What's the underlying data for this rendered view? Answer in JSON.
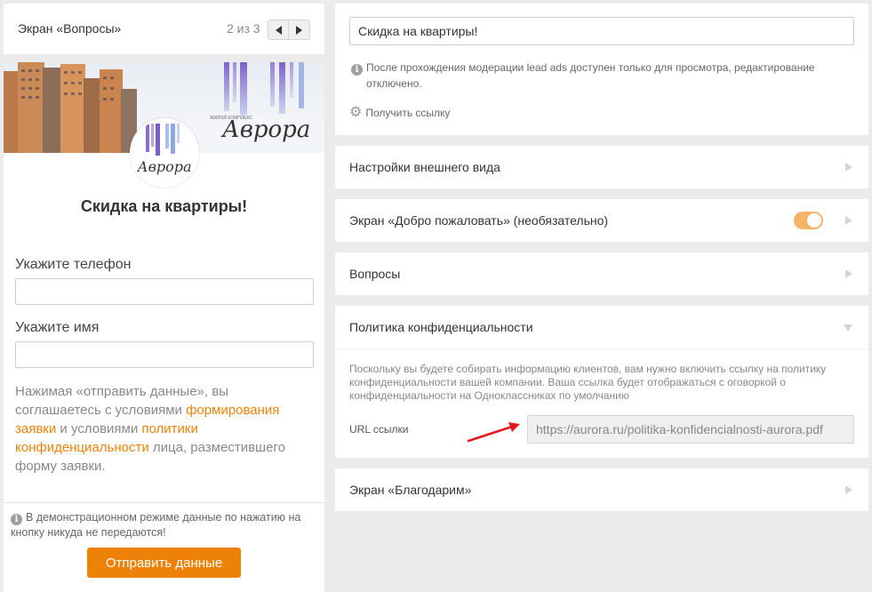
{
  "preview": {
    "screen_title": "Экран «Вопросы»",
    "pager": "2 из 3",
    "banner_logo_text": "Аврора",
    "banner_small_text": "ЖИЛОЙ КОМПЛЕКС",
    "form_title": "Скидка на квартиры!",
    "fields": [
      {
        "label": "Укажите телефон"
      },
      {
        "label": "Укажите имя"
      }
    ],
    "consent": {
      "part1": "Нажимая «отправить данные», вы соглашаетесь с условиями ",
      "link1": "формирования заявки",
      "part2": " и условиями ",
      "link2": "политики конфиденциальности",
      "part3": " лица, разместившего форму заявки."
    },
    "demo_note": "В демонстрационном режиме данные по нажатию на кнопку никуда не передаются!",
    "submit_label": "Отправить данные"
  },
  "settings": {
    "form_name": "Скидка на квартиры!",
    "moderation_note": "После прохождения модерации lead ads доступен только для просмотра, редактирование отключено.",
    "get_link": "Получить ссылку",
    "sections": {
      "appearance": "Настройки внешнего вида",
      "welcome": "Экран «Добро пожаловать» (необязательно)",
      "questions": "Вопросы",
      "privacy": "Политика конфиденциальности",
      "thanks": "Экран «Благодарим»"
    },
    "welcome_enabled": true,
    "privacy_desc": "Поскольку вы будете собирать информацию клиентов, вам нужно включить ссылку на политику конфиденциальности вашей компании. Ваша ссылка будет отображаться с оговоркой о конфиденциальности на Одноклассниках по умолчанию",
    "url_label": "URL ссылки",
    "url_value": "https://aurora.ru/politika-konfidencialnosti-aurora.pdf"
  },
  "colors": {
    "accent": "#ee8208",
    "toggle_on": "#f7b466",
    "annotation_arrow": "#e3191b",
    "background": "#ebebeb"
  },
  "icons": [
    "chevron-left-icon",
    "chevron-right-icon",
    "info-icon",
    "gear-icon",
    "expand-arrow-icon",
    "collapse-arrow-icon"
  ]
}
